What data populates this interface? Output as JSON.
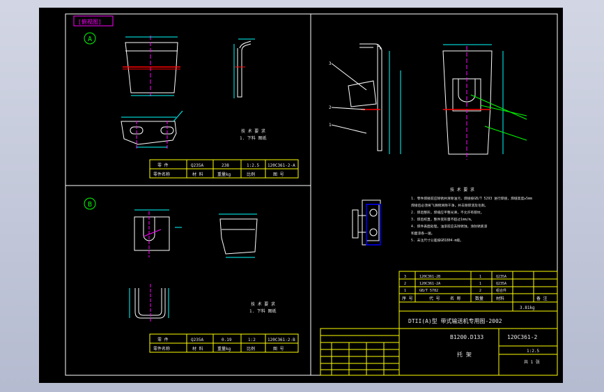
{
  "drawing": {
    "tag": "[俯视图]",
    "view_a": {
      "label": "A",
      "tech_title": "技 术 要 求",
      "tech_note": "1. 下料  图纸",
      "table": {
        "row1": [
          "零 件",
          "Q235A",
          "238",
          "1:2.5",
          "120C361-2-A"
        ],
        "row2": [
          "零件名称",
          "材  料",
          "重量kg",
          "比例",
          "图 号"
        ]
      }
    },
    "view_b": {
      "label": "B",
      "tech_title": "技 术 要 求",
      "tech_note": "1. 下料  图纸",
      "table": {
        "row1": [
          "零 件",
          "Q235A",
          "0.19",
          "1:2",
          "120C361-2-B"
        ],
        "row2": [
          "零件名称",
          "材  料",
          "重量kg",
          "比例",
          "图 号"
        ]
      }
    },
    "main": {
      "tech_title": "技 术 要 求",
      "tech_notes": [
        "1. 零件焊接前应除锈并清除油污，焊接按GB/T 5293 进行焊接，焊缝高度≥5mm",
        "   焊接后必须将飞溅物清除干净，并去除焊渣及毛刺。",
        "2. 焊后整形，焊缝应平整光滑，不允许有裂纹。",
        "3. 焊后校直，整件变形量不超过1mm/m。",
        "4. 焊件表面处理，油漆前应去除锈蚀，涂防锈底漆",
        "   和面漆各一遍。",
        "5. 未注尺寸公差按GB1804-m级。"
      ],
      "title_block": {
        "parts": [
          [
            "3",
            "120C361-2B",
            "1",
            "Q235A"
          ],
          [
            "2",
            "120C361-2A",
            "1",
            "Q235A"
          ],
          [
            "1",
            "GB/T 5782",
            "2",
            "组合件"
          ]
        ],
        "header": [
          "序 号",
          "代  号",
          "名  称",
          "数量",
          "材料",
          "备 注"
        ],
        "total_weight": "3.81kg",
        "series": "DTII(A)型 带式输送机专用图-2002",
        "model": "B1200.D133",
        "drawing_no": "120C361-2",
        "name": "托 架",
        "scale": "1:2.5",
        "sheet": "共 1 张"
      }
    }
  },
  "colors": {
    "frame": "#ffffff",
    "section": "#ffff00",
    "geometry": "#ffffff",
    "dimension": "#00ffff",
    "center": "#ff00ff",
    "highlight": "#ff0000",
    "leader": "#00ff00"
  }
}
